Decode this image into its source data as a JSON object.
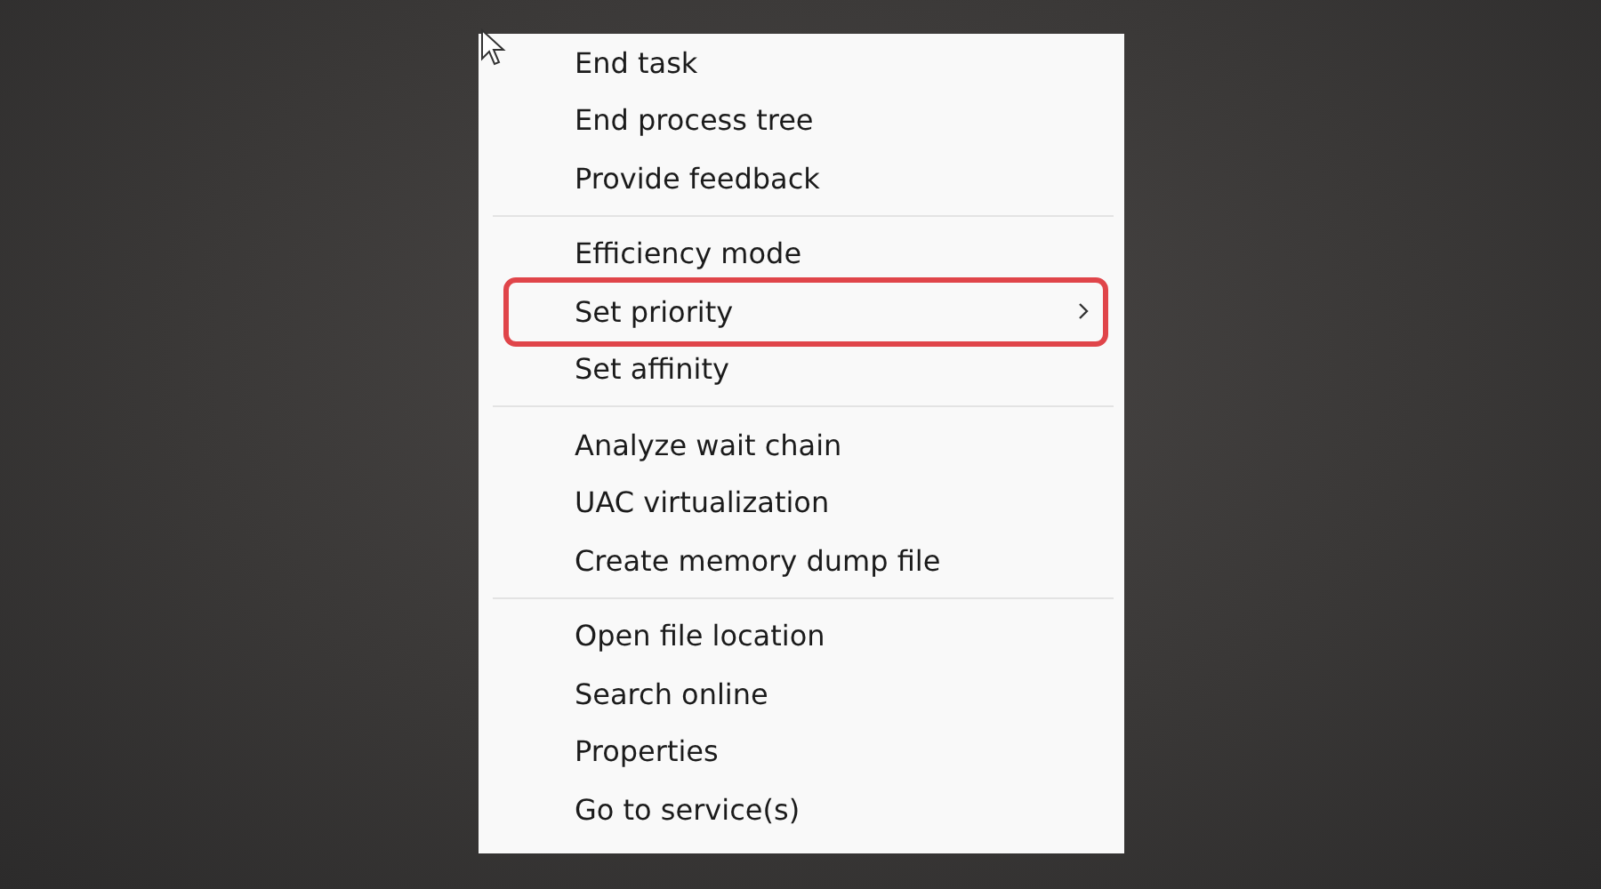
{
  "context_menu": {
    "groups": [
      {
        "items": [
          {
            "label": "End task",
            "submenu": false,
            "highlighted": false
          },
          {
            "label": "End process tree",
            "submenu": false,
            "highlighted": false
          },
          {
            "label": "Provide feedback",
            "submenu": false,
            "highlighted": false
          }
        ]
      },
      {
        "items": [
          {
            "label": "Efficiency mode",
            "submenu": false,
            "highlighted": false
          },
          {
            "label": "Set priority",
            "submenu": true,
            "highlighted": true
          },
          {
            "label": "Set affinity",
            "submenu": false,
            "highlighted": false
          }
        ]
      },
      {
        "items": [
          {
            "label": "Analyze wait chain",
            "submenu": false,
            "highlighted": false
          },
          {
            "label": "UAC virtualization",
            "submenu": false,
            "highlighted": false
          },
          {
            "label": "Create memory dump file",
            "submenu": false,
            "highlighted": false
          }
        ]
      },
      {
        "items": [
          {
            "label": "Open file location",
            "submenu": false,
            "highlighted": false
          },
          {
            "label": "Search online",
            "submenu": false,
            "highlighted": false
          },
          {
            "label": "Properties",
            "submenu": false,
            "highlighted": false
          },
          {
            "label": "Go to service(s)",
            "submenu": false,
            "highlighted": false
          }
        ]
      }
    ]
  }
}
